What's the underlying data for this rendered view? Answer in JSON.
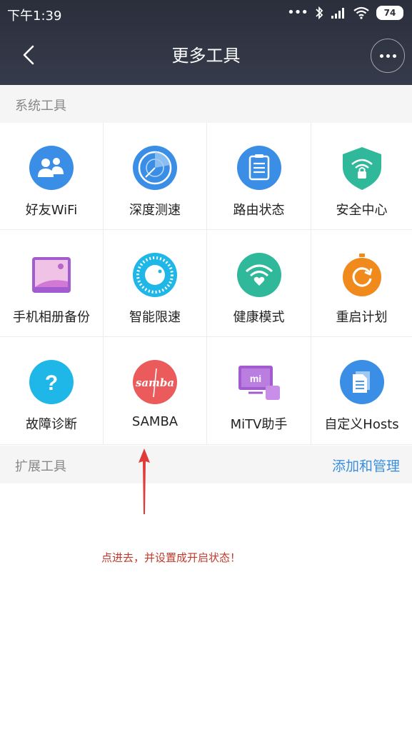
{
  "status_bar": {
    "time": "下午1:39",
    "dots": "•••",
    "battery": "74"
  },
  "header": {
    "title": "更多工具"
  },
  "system_section": {
    "label": "系统工具"
  },
  "tools": [
    {
      "name": "好友WiFi",
      "icon": "friends-wifi-icon"
    },
    {
      "name": "深度测速",
      "icon": "radar-speedtest-icon"
    },
    {
      "name": "路由状态",
      "icon": "clipboard-status-icon"
    },
    {
      "name": "安全中心",
      "icon": "security-shield-icon"
    },
    {
      "name": "手机相册备份",
      "icon": "photo-album-icon"
    },
    {
      "name": "智能限速",
      "icon": "speed-dial-icon"
    },
    {
      "name": "健康模式",
      "icon": "health-wifi-heart-icon"
    },
    {
      "name": "重启计划",
      "icon": "restart-timer-icon"
    },
    {
      "name": "故障诊断",
      "icon": "question-help-icon"
    },
    {
      "name": "SAMBA",
      "icon": "samba-icon"
    },
    {
      "name": "MiTV助手",
      "icon": "mitv-icon"
    },
    {
      "name": "自定义Hosts",
      "icon": "hosts-document-icon"
    }
  ],
  "samba_icon_text": "samba",
  "mitv_icon_text": "mi",
  "ext_section": {
    "label": "扩展工具",
    "action": "添加和管理"
  },
  "annotation": {
    "text": "点进去，并设置成开启状态！"
  },
  "colors": {
    "header": "#2f3342",
    "accent_blue": "#3a8fe0",
    "annotation_red": "#c0392b"
  }
}
